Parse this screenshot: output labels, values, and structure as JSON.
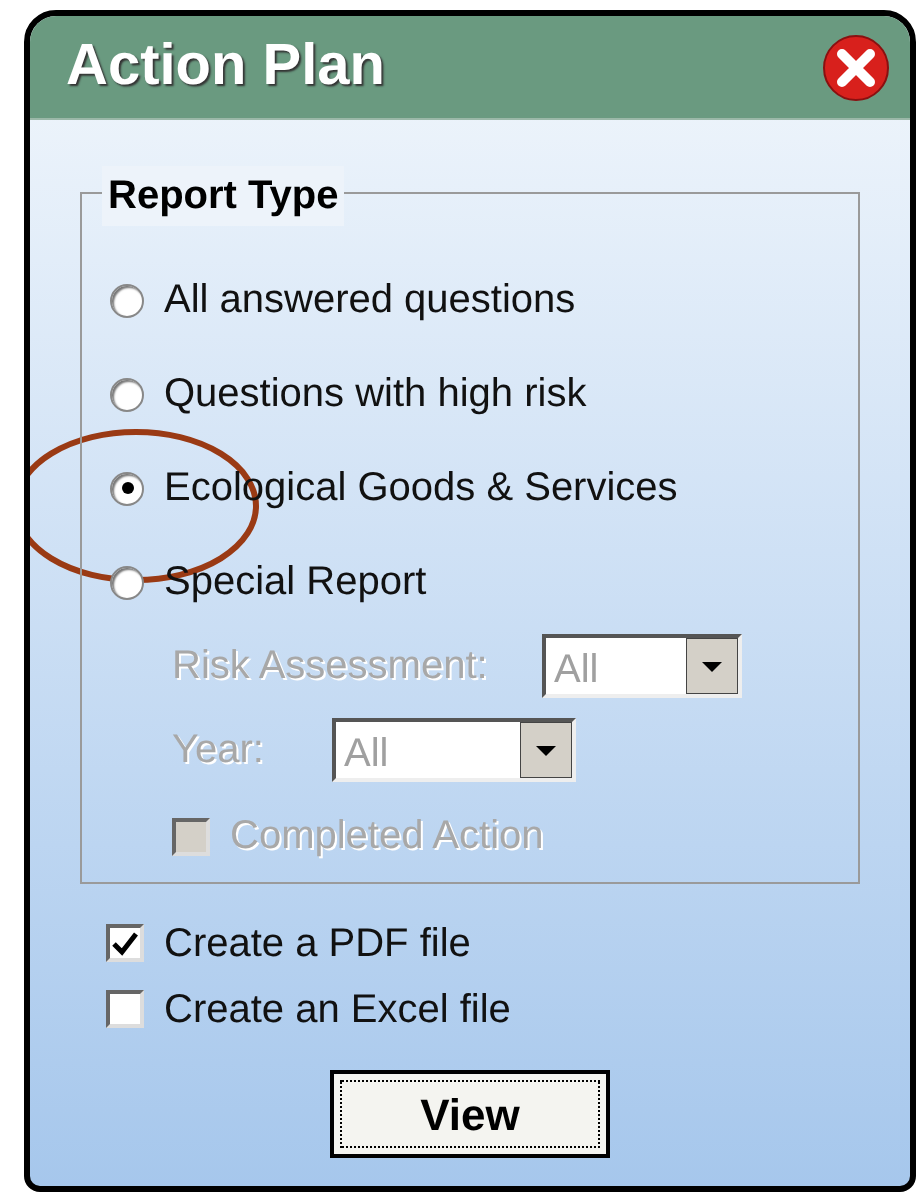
{
  "window": {
    "title": "Action Plan"
  },
  "report_type": {
    "legend": "Report Type",
    "options": [
      {
        "label": "All answered questions",
        "selected": false
      },
      {
        "label": "Questions with high risk",
        "selected": false
      },
      {
        "label": "Ecological Goods & Services",
        "selected": true
      },
      {
        "label": "Special Report",
        "selected": false
      }
    ],
    "filters": [
      {
        "label": "Risk Assessment:",
        "value": "All",
        "disabled": true
      },
      {
        "label": "Year:",
        "value": "All",
        "disabled": true
      }
    ],
    "completed_action": {
      "label": "Completed Action",
      "checked": false,
      "disabled": true
    }
  },
  "outputs": [
    {
      "label": "Create a PDF file",
      "checked": true
    },
    {
      "label": "Create an Excel file",
      "checked": false
    }
  ],
  "view_button": "View"
}
